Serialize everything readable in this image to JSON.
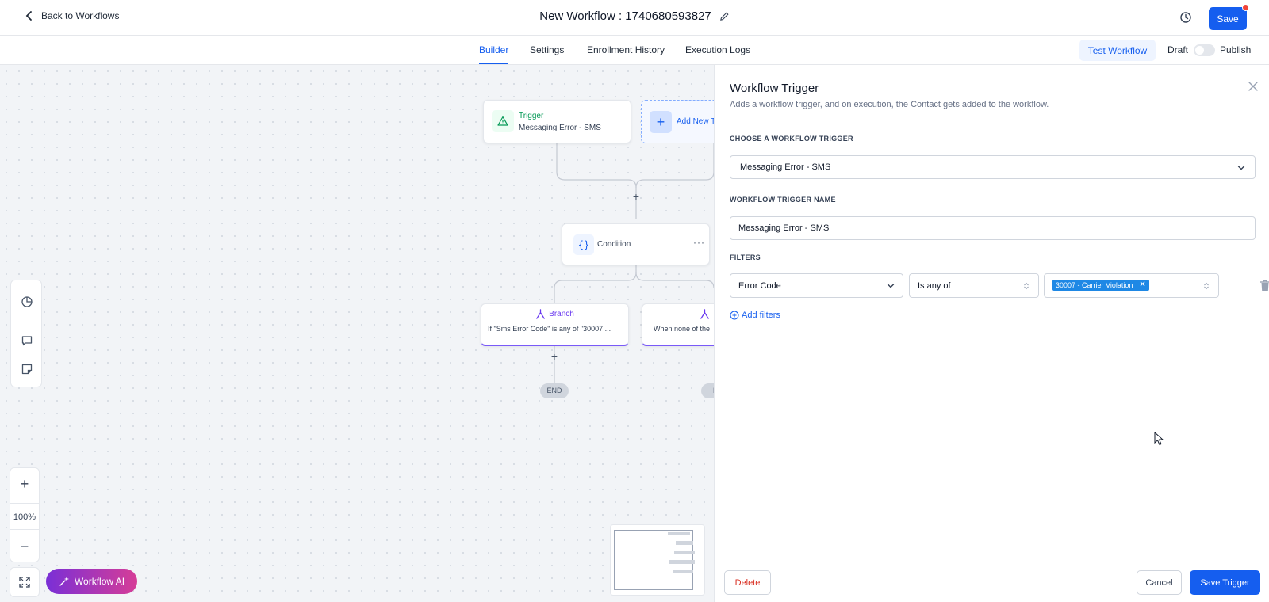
{
  "header": {
    "back_label": "Back to Workflows",
    "workflow_title": "New Workflow : 1740680593827",
    "save_label": "Save"
  },
  "tabs": [
    {
      "label": "Builder",
      "active": true
    },
    {
      "label": "Settings",
      "active": false
    },
    {
      "label": "Enrollment History",
      "active": false
    },
    {
      "label": "Execution Logs",
      "active": false
    }
  ],
  "toolbar": {
    "test_workflow_label": "Test Workflow",
    "draft_label": "Draft",
    "publish_label": "Publish",
    "publish_toggle_on": false
  },
  "canvas": {
    "trigger_node": {
      "label": "Trigger",
      "subtitle": "Messaging Error - SMS"
    },
    "add_trigger_label": "Add New T",
    "condition_node": {
      "label": "Condition"
    },
    "branches": [
      {
        "label": "Branch",
        "subtitle": "If \"Sms Error Code\" is any of \"30007 ..."
      },
      {
        "label": "",
        "subtitle": "When none of the"
      }
    ],
    "end_label": "END",
    "end_label_b": "E",
    "zoom_level": "100%",
    "workflow_ai_label": "Workflow AI"
  },
  "panel": {
    "title": "Workflow Trigger",
    "description": "Adds a workflow trigger, and on execution, the Contact gets added to the workflow.",
    "choose_label": "CHOOSE A WORKFLOW TRIGGER",
    "trigger_value": "Messaging Error - SMS",
    "name_label": "WORKFLOW TRIGGER NAME",
    "name_value": "Messaging Error - SMS",
    "filters_label": "FILTERS",
    "filter": {
      "field": "Error Code",
      "operator": "Is any of",
      "tag": "30007 - Carrier Violation"
    },
    "add_filters_label": "Add filters",
    "delete_label": "Delete",
    "cancel_label": "Cancel",
    "save_trigger_label": "Save Trigger"
  },
  "colors": {
    "primary": "#155eef",
    "trigger_green": "#039855",
    "branch_purple": "#6938ef",
    "danger": "#d92d20",
    "tag_blue": "#1e88e5"
  }
}
